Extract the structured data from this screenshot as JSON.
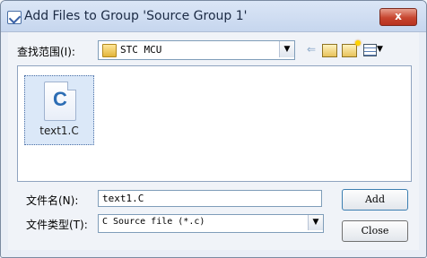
{
  "window": {
    "title": "Add Files to Group 'Source Group 1'",
    "close_glyph": "x"
  },
  "look_in": {
    "label": "查找范围(I):",
    "value": "STC MCU",
    "back_glyph": "⇐",
    "dropdown_glyph": "▼"
  },
  "files": [
    {
      "icon_letter": "C",
      "name": "text1.C",
      "selected": true
    }
  ],
  "filename": {
    "label": "文件名(N):",
    "value": "text1.C"
  },
  "filetype": {
    "label": "文件类型(T):",
    "value": "C Source file (*.c)",
    "dropdown_glyph": "▼"
  },
  "buttons": {
    "add": "Add",
    "close": "Close"
  },
  "colors": {
    "titlebar": "#c6d6ee",
    "close_button": "#c7452f",
    "selection": "#dbe8f8"
  }
}
